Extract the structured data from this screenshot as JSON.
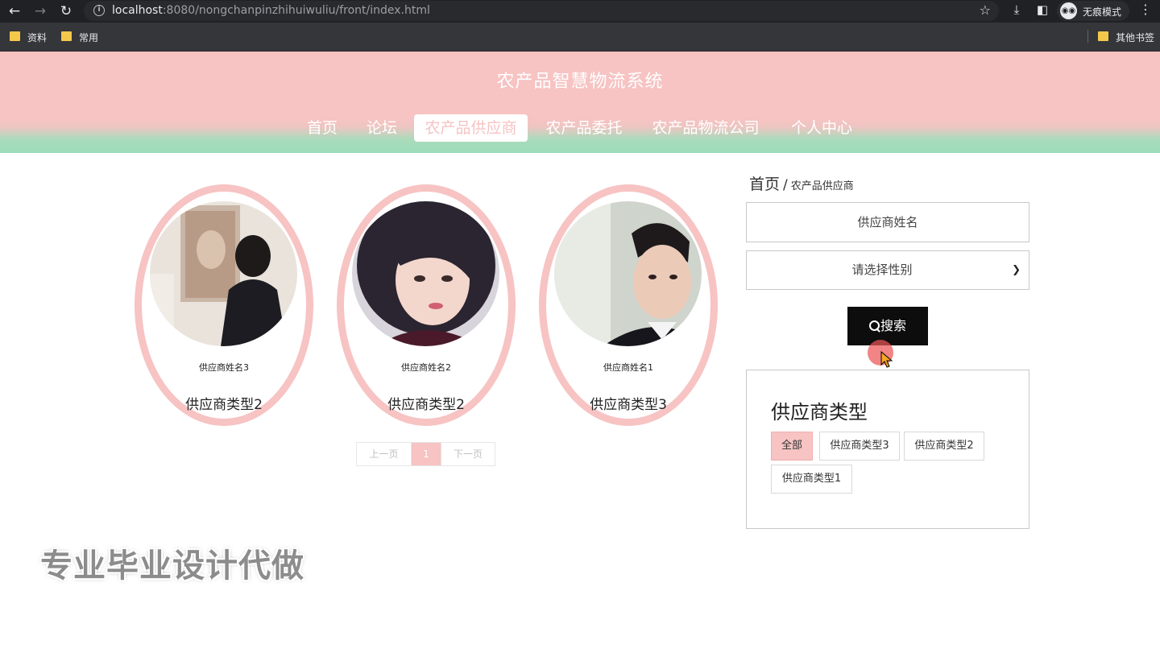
{
  "browser": {
    "url_host": "localhost",
    "url_rest": ":8080/nongchanpinzhihuiwuliu/front/index.html",
    "incognito_label": "无痕模式",
    "bookmarks": [
      "资料",
      "常用"
    ],
    "other_bookmarks": "其他书签"
  },
  "site": {
    "title": "农产品智慧物流系统",
    "nav": [
      "首页",
      "论坛",
      "农产品供应商",
      "农产品委托",
      "农产品物流公司",
      "个人中心"
    ],
    "active_nav": "农产品供应商"
  },
  "cards": [
    {
      "name": "供应商姓名3",
      "type": "供应商类型2"
    },
    {
      "name": "供应商姓名2",
      "type": "供应商类型2"
    },
    {
      "name": "供应商姓名1",
      "type": "供应商类型3"
    }
  ],
  "pagination": {
    "prev": "上一页",
    "current": "1",
    "next": "下一页"
  },
  "breadcrumb": {
    "home": "首页",
    "sep": "/",
    "current": "农产品供应商"
  },
  "search": {
    "name_placeholder": "供应商姓名",
    "gender_placeholder": "请选择性别",
    "button_label": "搜索"
  },
  "type_filter": {
    "title": "供应商类型",
    "chips": [
      "全部",
      "供应商类型3",
      "供应商类型2",
      "供应商类型1"
    ],
    "active": "全部"
  },
  "watermark": "专业毕业设计代做",
  "colors": {
    "brand_pink": "#f7c3c3",
    "brand_green": "#9cdcb9",
    "search_button": "#0d0d0d"
  }
}
